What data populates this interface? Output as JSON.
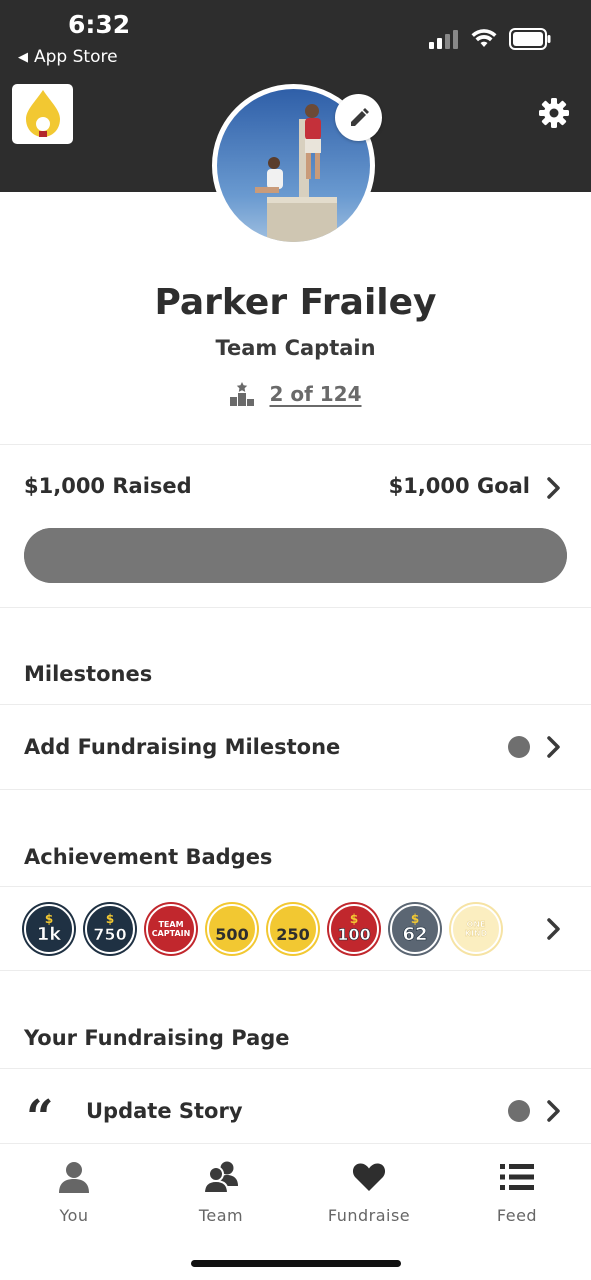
{
  "status_bar": {
    "time": "6:32",
    "back_label": "App Store"
  },
  "header": {
    "logo": "flame-logo",
    "settings_icon": "gear-icon",
    "edit_icon": "pencil-icon"
  },
  "profile": {
    "name": "Parker Frailey",
    "role": "Team Captain",
    "rank_icon": "podium-icon",
    "rank_text": "2 of 124"
  },
  "fundraising": {
    "raised_label": "$1,000 Raised",
    "goal_label": "$1,000 Goal",
    "progress_fraction": 1.0
  },
  "milestones": {
    "section_title": "Milestones",
    "add_label": "Add Fundraising Milestone"
  },
  "badges": {
    "section_title": "Achievement Badges",
    "items": [
      {
        "label": "1k",
        "prefix": "$",
        "bg": "#1f3143",
        "ring": "#1f3143"
      },
      {
        "label": "750",
        "prefix": "$",
        "bg": "#1f3143",
        "ring": "#1f3143"
      },
      {
        "label": "TEAM CAPTAIN",
        "prefix": "",
        "bg": "#c1272d",
        "ring": "#c1272d"
      },
      {
        "label": "500",
        "prefix": "$",
        "bg": "#f2c832",
        "ring": "#f2c832"
      },
      {
        "label": "250",
        "prefix": "$",
        "bg": "#f2c832",
        "ring": "#f2c832"
      },
      {
        "label": "100",
        "prefix": "$",
        "bg": "#c1272d",
        "ring": "#c1272d"
      },
      {
        "label": "62",
        "prefix": "$",
        "bg": "#5b6673",
        "ring": "#5b6673"
      },
      {
        "label": "ONE KIND",
        "prefix": "",
        "bg": "#fbeec0",
        "ring": "#f6e3a4"
      }
    ]
  },
  "fundraising_page": {
    "section_title": "Your Fundraising Page",
    "update_story_label": "Update Story",
    "quote_icon": "quote-icon"
  },
  "tabbar": {
    "tabs": [
      {
        "label": "You",
        "icon": "person-icon"
      },
      {
        "label": "Team",
        "icon": "team-icon"
      },
      {
        "label": "Fundraise",
        "icon": "heart-icon"
      },
      {
        "label": "Feed",
        "icon": "list-icon"
      }
    ]
  },
  "colors": {
    "header_bg": "#2d2d2d",
    "progress": "#767676",
    "logo_flame": "#f2c832"
  }
}
